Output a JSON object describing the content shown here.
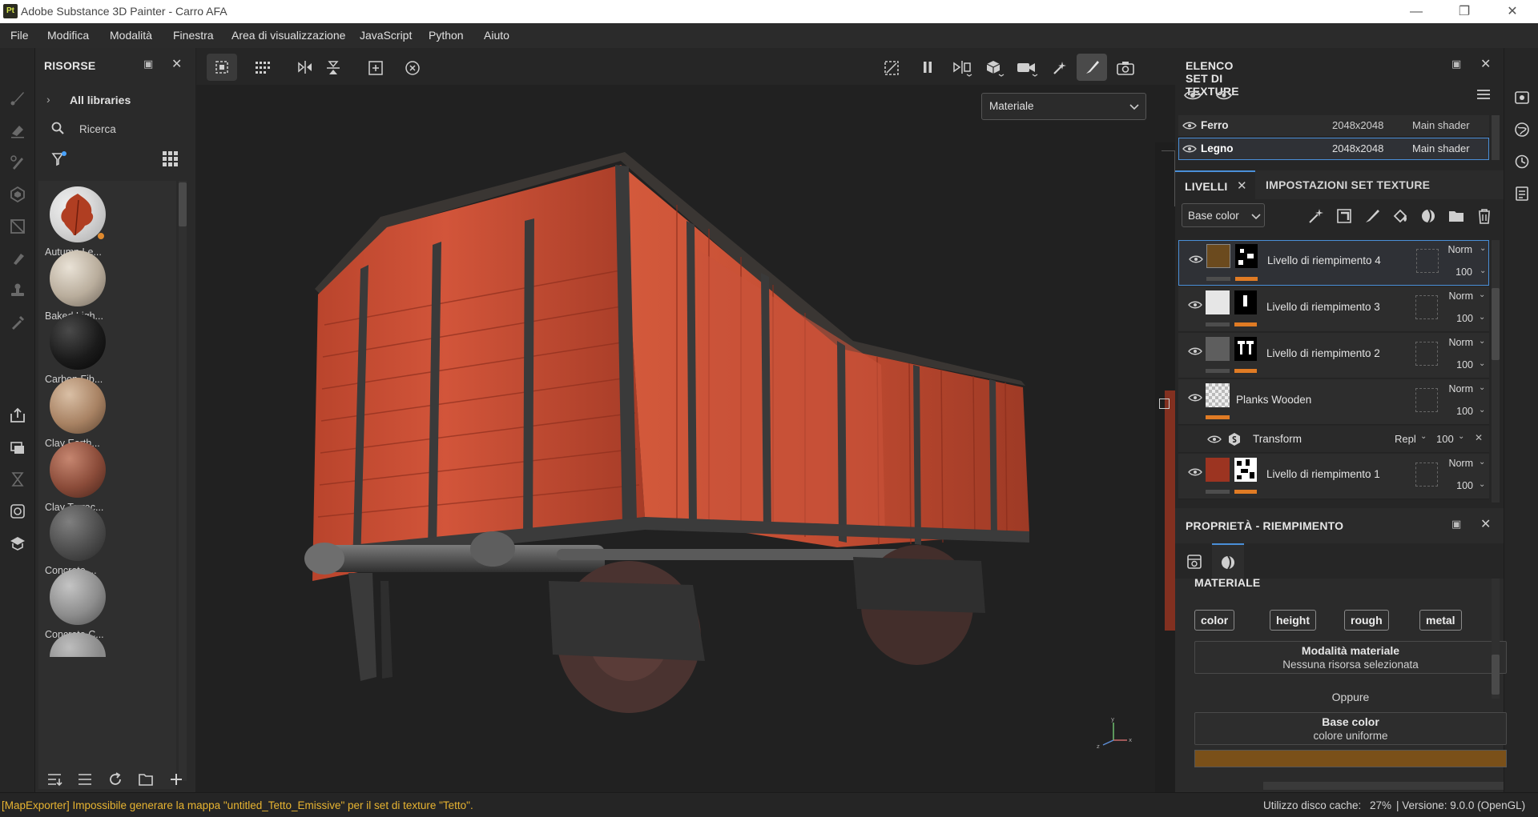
{
  "window": {
    "title": "Adobe Substance 3D Painter - Carro AFA",
    "logo": "Pt"
  },
  "menu": [
    "File",
    "Modifica",
    "Modalità",
    "Finestra",
    "Area di visualizzazione",
    "JavaScript",
    "Python",
    "Aiuto"
  ],
  "resources": {
    "title": "RISORSE",
    "library": "All libraries",
    "search_placeholder": "Ricerca",
    "items": [
      {
        "label": "Autumn Le...",
        "color": "#b3462e"
      },
      {
        "label": "Baked Ligh...",
        "color": "#b9ad9c"
      },
      {
        "label": "Carbon Fib...",
        "color": "#1a1a1a"
      },
      {
        "label": "Clay Earth...",
        "color": "#a88263"
      },
      {
        "label": "Clay Terrac...",
        "color": "#8a4b39"
      },
      {
        "label": "Concrete ...",
        "color": "#545454"
      },
      {
        "label": "Concrete C...",
        "color": "#8d8d8d"
      }
    ]
  },
  "viewport": {
    "mode": "Materiale"
  },
  "texture_sets": {
    "title": "ELENCO SET DI TEXTURE",
    "rows": [
      {
        "name": "Ferro",
        "size": "2048x2048",
        "shader": "Main shader"
      },
      {
        "name": "Legno",
        "size": "2048x2048",
        "shader": "Main shader"
      }
    ]
  },
  "layers": {
    "tab_layers": "LIVELLI",
    "tab_settings": "IMPOSTAZIONI SET TEXTURE",
    "channel": "Base color",
    "rows": [
      {
        "name": "Livello di riempimento 4",
        "blend": "Norm",
        "opacity": "100",
        "swatch": "#6b4a1e"
      },
      {
        "name": "Livello di riempimento 3",
        "blend": "Norm",
        "opacity": "100",
        "swatch": "#e6e6e6"
      },
      {
        "name": "Livello di riempimento 2",
        "blend": "Norm",
        "opacity": "100",
        "swatch": "#5e5e5e"
      },
      {
        "name": "Planks Wooden",
        "blend": "Norm",
        "opacity": "100",
        "swatch": "#888888"
      },
      {
        "name": "Livello di riempimento 1",
        "blend": "Norm",
        "opacity": "100",
        "swatch": "#9c3421"
      }
    ],
    "transform": {
      "name": "Transform",
      "blend": "Repl",
      "opacity": "100"
    }
  },
  "properties": {
    "title": "PROPRIETÀ - RIEMPIMENTO",
    "section": "MATERIALE",
    "channels": [
      "color",
      "height",
      "rough",
      "metal"
    ],
    "material_mode_title": "Modalità materiale",
    "material_mode_value": "Nessuna risorsa selezionata",
    "or_label": "Oppure",
    "base_color_title": "Base color",
    "base_color_value": "colore uniforme",
    "base_color_swatch": "#7a5019"
  },
  "status": {
    "message": "[MapExporter] Impossibile generare la mappa \"untitled_Tetto_Emissive\" per il set di texture \"Tetto\".",
    "cache_label": "Utilizzo disco cache:",
    "cache_value": "27%",
    "version": "| Versione: 9.0.0 (OpenGL)"
  }
}
